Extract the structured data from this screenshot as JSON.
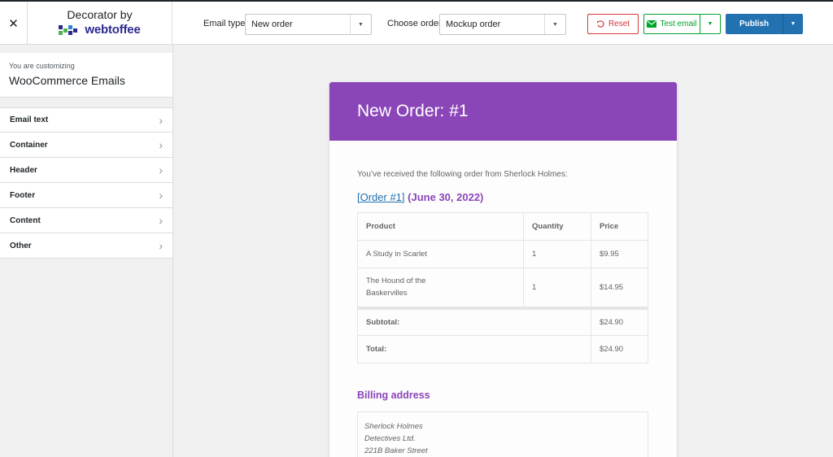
{
  "topbar": {
    "close_glyph": "✕",
    "brand_title": "Decorator by",
    "brand_word": "webtoffee",
    "email_type_label": "Email type",
    "email_type_value": "New order",
    "choose_order_label": "Choose order",
    "choose_order_value": "Mockup order",
    "reset_label": "Reset",
    "test_email_label": "Test email",
    "publish_label": "Publish"
  },
  "sidebar": {
    "customizing_small": "You are customizing",
    "customizing_big": "WooCommerce Emails",
    "items": [
      {
        "label": "Email text"
      },
      {
        "label": "Container"
      },
      {
        "label": "Header"
      },
      {
        "label": "Footer"
      },
      {
        "label": "Content"
      },
      {
        "label": "Other"
      }
    ]
  },
  "email": {
    "header_title": "New Order: #1",
    "intro": "You’ve received the following order from Sherlock Holmes:",
    "order_link": "[Order #1]",
    "order_date": "(June 30, 2022)",
    "table": {
      "headers": [
        "Product",
        "Quantity",
        "Price"
      ],
      "rows": [
        {
          "product": "A Study in Scarlet",
          "quantity": "1",
          "price": "$9.95"
        },
        {
          "product_line1": "The Hound of the",
          "product_line2": "Baskervilles",
          "quantity": "1",
          "price": "$14.95"
        }
      ],
      "subtotal_label": "Subtotal:",
      "subtotal_value": "$24.90",
      "total_label": "Total:",
      "total_value": "$24.90"
    },
    "billing_title": "Billing address",
    "address": [
      "Sherlock Holmes",
      "Detectives Ltd.",
      "221B Baker Street"
    ]
  },
  "colors": {
    "header_purple": "#8a45b8",
    "publish_blue": "#2271b1",
    "reset_red": "#d63638",
    "test_green": "#00a32a"
  },
  "icons": {
    "close": "close-icon",
    "reset": "undo-icon",
    "test": "envelope-icon",
    "dropdown": "caret-down-icon",
    "menu_chevron": "chevron-right-icon"
  }
}
